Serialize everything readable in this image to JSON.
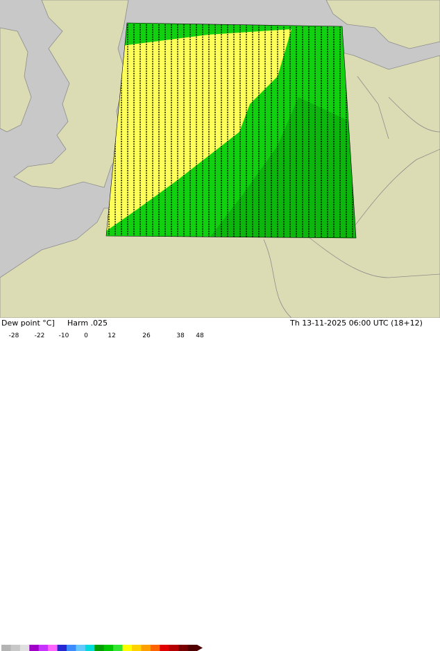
{
  "header": {
    "parameter_label": "Dew point °C]",
    "model_label": "Harm .025",
    "valid_time_label": "Th 13-11-2025 06:00 UTC (18+12)"
  },
  "legend": {
    "ticks": [
      "-28",
      "-22",
      "-10",
      "0",
      "12",
      "26",
      "38",
      "48"
    ],
    "colors": [
      "#b4b4b4",
      "#c8c8c8",
      "#e0e0e0",
      "#a000c8",
      "#c832ff",
      "#ff64ff",
      "#2828d2",
      "#3c8cff",
      "#64c8ff",
      "#00dcdc",
      "#00a000",
      "#00c800",
      "#32e632",
      "#ffff00",
      "#ffd200",
      "#ffa000",
      "#ff6400",
      "#e10000",
      "#b40000",
      "#780000",
      "#500000"
    ]
  },
  "map": {
    "colors": {
      "sea": "#c8c8c8",
      "land": "#dcdcb4",
      "border": "#8c8c8c",
      "field_yellow": "#ffff5a",
      "field_green": "#10d010",
      "field_dark_green": "#0aa00a"
    }
  }
}
